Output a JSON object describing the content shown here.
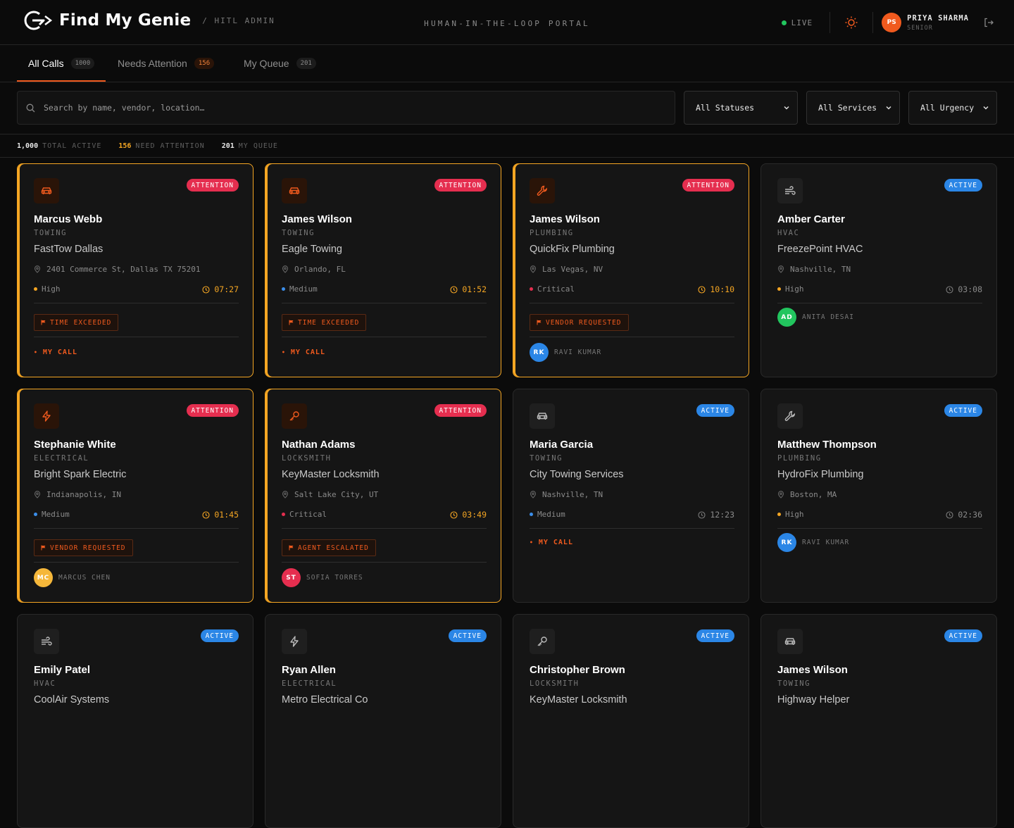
{
  "header": {
    "brand": "Find My Genie",
    "sub": "/ HITL ADMIN",
    "portal": "HUMAN-IN-THE-LOOP PORTAL",
    "live": "LIVE",
    "user_initials": "PS",
    "user_name": "PRIYA SHARMA",
    "user_role": "SENIOR"
  },
  "tabs": [
    {
      "label": "All Calls",
      "count": "1000"
    },
    {
      "label": "Needs Attention",
      "count": "156"
    },
    {
      "label": "My Queue",
      "count": "201"
    }
  ],
  "filters": {
    "search_placeholder": "Search by name, vendor, location…",
    "status": "All Statuses",
    "services": "All Services",
    "urgency": "All Urgency"
  },
  "stats": [
    {
      "value": "1,000",
      "label": "TOTAL ACTIVE"
    },
    {
      "value": "156",
      "label": "NEED ATTENTION"
    },
    {
      "value": "201",
      "label": "MY QUEUE"
    }
  ],
  "colors": {
    "accent": "#f05a1e",
    "attention": "#f5a623",
    "pill_attention": "#e52e4f",
    "pill_active": "#2b86e6"
  },
  "cards": [
    {
      "status": "ATTENTION",
      "icon": "car-icon",
      "name": "Marcus Webb",
      "service": "TOWING",
      "vendor": "FastTow Dallas",
      "location": "2401 Commerce St, Dallas TX 75201",
      "urgency": "High",
      "time": "07:27",
      "flag": "TIME EXCEEDED",
      "mycall": "MY CALL"
    },
    {
      "status": "ATTENTION",
      "icon": "car-icon",
      "name": "James Wilson",
      "service": "TOWING",
      "vendor": "Eagle Towing",
      "location": "Orlando, FL",
      "urgency": "Medium",
      "time": "01:52",
      "flag": "TIME EXCEEDED",
      "mycall": "MY CALL"
    },
    {
      "status": "ATTENTION",
      "icon": "wrench-icon",
      "name": "James Wilson",
      "service": "PLUMBING",
      "vendor": "QuickFix Plumbing",
      "location": "Las Vegas, NV",
      "urgency": "Critical",
      "time": "10:10",
      "flag": "VENDOR REQUESTED",
      "agent_initials": "RK",
      "agent": "RAVI KUMAR",
      "agent_color": "#2b86e6"
    },
    {
      "status": "ACTIVE",
      "icon": "wind-icon",
      "name": "Amber Carter",
      "service": "HVAC",
      "vendor": "FreezePoint HVAC",
      "location": "Nashville, TN",
      "urgency": "High",
      "time": "03:08",
      "agent_initials": "AD",
      "agent": "ANITA DESAI",
      "agent_color": "#22c55e"
    },
    {
      "status": "ATTENTION",
      "icon": "bolt-icon",
      "name": "Stephanie White",
      "service": "ELECTRICAL",
      "vendor": "Bright Spark Electric",
      "location": "Indianapolis, IN",
      "urgency": "Medium",
      "time": "01:45",
      "flag": "VENDOR REQUESTED",
      "agent_initials": "MC",
      "agent": "MARCUS CHEN",
      "agent_color": "#f5b73a"
    },
    {
      "status": "ATTENTION",
      "icon": "key-icon",
      "name": "Nathan Adams",
      "service": "LOCKSMITH",
      "vendor": "KeyMaster Locksmith",
      "location": "Salt Lake City, UT",
      "urgency": "Critical",
      "time": "03:49",
      "flag": "AGENT ESCALATED",
      "agent_initials": "ST",
      "agent": "SOFIA TORRES",
      "agent_color": "#e52e4f"
    },
    {
      "status": "ACTIVE",
      "icon": "car-icon",
      "name": "Maria Garcia",
      "service": "TOWING",
      "vendor": "City Towing Services",
      "location": "Nashville, TN",
      "urgency": "Medium",
      "time": "12:23",
      "mycall": "MY CALL"
    },
    {
      "status": "ACTIVE",
      "icon": "wrench-icon",
      "name": "Matthew Thompson",
      "service": "PLUMBING",
      "vendor": "HydroFix Plumbing",
      "location": "Boston, MA",
      "urgency": "High",
      "time": "02:36",
      "agent_initials": "RK",
      "agent": "RAVI KUMAR",
      "agent_color": "#2b86e6"
    },
    {
      "status": "ACTIVE",
      "icon": "wind-icon",
      "name": "Emily Patel",
      "service": "HVAC",
      "vendor": "CoolAir Systems"
    },
    {
      "status": "ACTIVE",
      "icon": "bolt-icon",
      "name": "Ryan Allen",
      "service": "ELECTRICAL",
      "vendor": "Metro Electrical Co"
    },
    {
      "status": "ACTIVE",
      "icon": "key-icon",
      "name": "Christopher Brown",
      "service": "LOCKSMITH",
      "vendor": "KeyMaster Locksmith"
    },
    {
      "status": "ACTIVE",
      "icon": "car-icon",
      "name": "James Wilson",
      "service": "TOWING",
      "vendor": "Highway Helper"
    }
  ]
}
